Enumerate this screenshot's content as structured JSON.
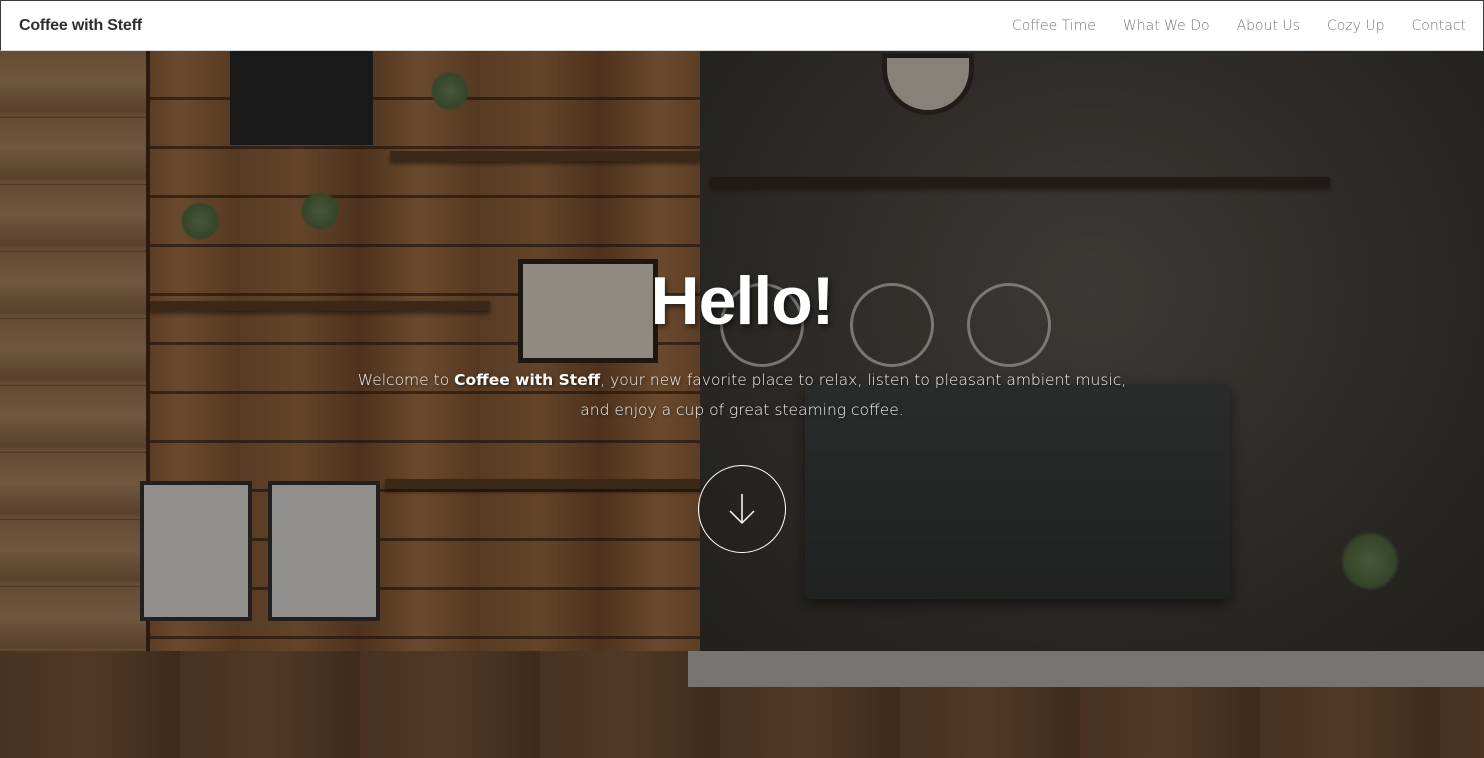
{
  "navbar": {
    "brand": "Coffee with Steff",
    "links": [
      {
        "label": "Coffee Time"
      },
      {
        "label": "What We Do"
      },
      {
        "label": "About Us"
      },
      {
        "label": "Cozy Up"
      },
      {
        "label": "Contact"
      }
    ]
  },
  "hero": {
    "title": "Hello!",
    "intro_before": "Welcome to ",
    "intro_brand": "Coffee with Steff",
    "intro_after": ", your new favorite place to relax, listen to pleasant ambient music, and enjoy a cup of great steaming coffee.",
    "scroll_icon": "arrow-down-icon",
    "background": "cafe-interior-photo"
  }
}
